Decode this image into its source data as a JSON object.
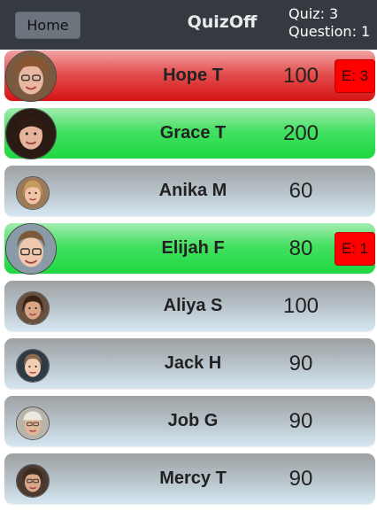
{
  "header": {
    "home_label": "Home",
    "brand": "QuizOff",
    "quiz_label": "Quiz: 3",
    "question_label": "Question: 1"
  },
  "colors": {
    "topbar": "#343a40",
    "home_button": "#6c757d",
    "wrong_row": "#e0332f",
    "right_row": "#2bdc4b",
    "neutral_row": "#b9c5cc",
    "error_badge": "#ff0000"
  },
  "players": [
    {
      "name": "Hope T",
      "score": "100",
      "status": "wrong",
      "error": "E: 3",
      "avatar_icon": "player-photo"
    },
    {
      "name": "Grace T",
      "score": "200",
      "status": "right",
      "error": "",
      "avatar_icon": "player-photo"
    },
    {
      "name": "Anika M",
      "score": "60",
      "status": "neutral",
      "error": "",
      "avatar_icon": "player-photo"
    },
    {
      "name": "Elijah F",
      "score": "80",
      "status": "right",
      "error": "E: 1",
      "avatar_icon": "player-photo"
    },
    {
      "name": "Aliya S",
      "score": "100",
      "status": "neutral",
      "error": "",
      "avatar_icon": "player-photo"
    },
    {
      "name": "Jack H",
      "score": "90",
      "status": "neutral",
      "error": "",
      "avatar_icon": "player-photo"
    },
    {
      "name": "Job G",
      "score": "90",
      "status": "neutral",
      "error": "",
      "avatar_icon": "player-photo"
    },
    {
      "name": "Mercy T",
      "score": "90",
      "status": "neutral",
      "error": "",
      "avatar_icon": "player-photo"
    }
  ]
}
